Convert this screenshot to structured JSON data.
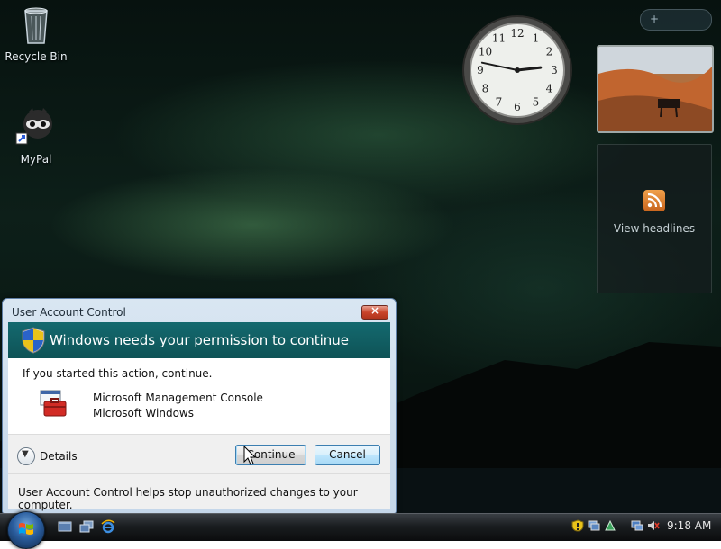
{
  "desktop": {
    "icons": [
      {
        "label": "Recycle Bin",
        "icon": "recycle-bin-icon"
      },
      {
        "label": "MyPal",
        "icon": "raccoon-shortcut-icon"
      }
    ]
  },
  "clock": {
    "hours": 2,
    "minutes": 47,
    "numbers": [
      "12",
      "1",
      "2",
      "3",
      "4",
      "5",
      "6",
      "7",
      "8",
      "9",
      "10",
      "11"
    ]
  },
  "gadgets": {
    "feed_label": "View headlines",
    "feed_icon": "rss-icon",
    "slideshow_icon": "desert-photo"
  },
  "uac": {
    "window_title": "User Account Control",
    "header": "Windows needs your permission to continue",
    "intro": "If you started this action, continue.",
    "program_name": "Microsoft Management Console",
    "publisher": "Microsoft Windows",
    "details_label": "Details",
    "continue_label": "Continue",
    "cancel_label": "Cancel",
    "footer": "User Account Control helps stop unauthorized changes to your computer."
  },
  "taskbar": {
    "start_icon": "windows-flag-icon",
    "quick_launch": [
      "show-desktop-icon",
      "switch-windows-icon",
      "internet-explorer-icon"
    ],
    "tray_icons": [
      "security-warning-icon",
      "network-icon",
      "sidebar-icon",
      "display-icon",
      "volume-muted-icon"
    ],
    "time": "9:18 AM"
  },
  "colors": {
    "uac_header": "#14696f",
    "taskbar": "#1a1d20",
    "accent": "#3c7fb1"
  }
}
